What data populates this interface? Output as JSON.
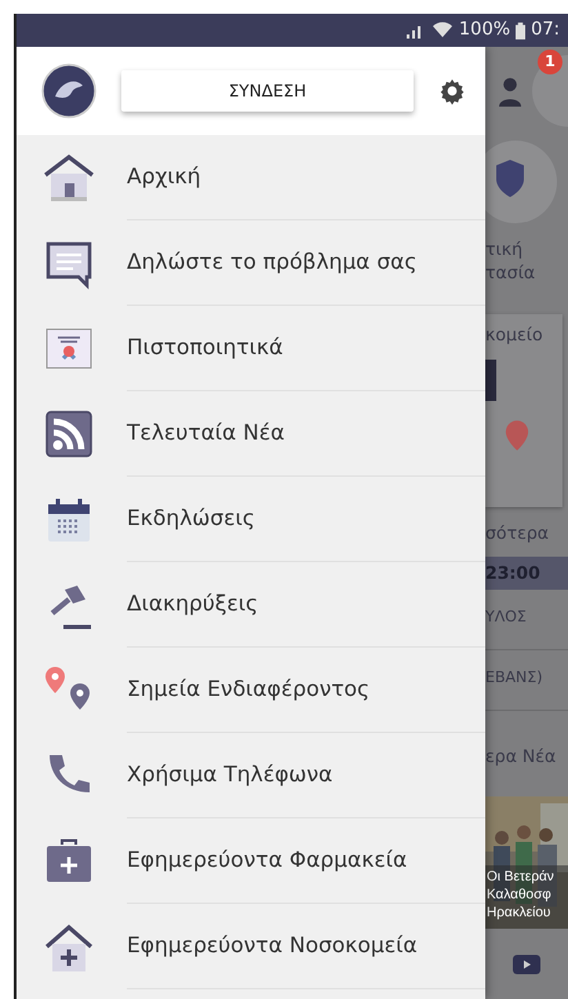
{
  "status_bar": {
    "battery": "100%",
    "time": "07:"
  },
  "drawer": {
    "login_button": "ΣΥΝΔΕΣΗ",
    "items": [
      {
        "kind": "home",
        "label": "Αρχική"
      },
      {
        "kind": "chat",
        "label": "Δηλώστε το πρόβλημα σας"
      },
      {
        "kind": "certificate",
        "label": "Πιστοποιητικά"
      },
      {
        "kind": "rss",
        "label": "Τελευταία Νέα"
      },
      {
        "kind": "calendar",
        "label": "Εκδηλώσεις"
      },
      {
        "kind": "gavel",
        "label": "Διακηρύξεις"
      },
      {
        "kind": "pins",
        "label": "Σημεία Ενδιαφέροντος"
      },
      {
        "kind": "phone",
        "label": "Χρήσιμα Τηλέφωνα"
      },
      {
        "kind": "pharmacy",
        "label": "Εφημερεύοντα Φαρμακεία"
      },
      {
        "kind": "hospital",
        "label": "Εφημερεύοντα Νοσοκομεία"
      }
    ]
  },
  "background": {
    "notification_count": "1",
    "service_label": [
      "τική",
      "τασία"
    ],
    "card_title": "κομείο",
    "more_link": "σότερα",
    "event_time": "23:00",
    "event_rows": [
      "ΥΛΟΣ",
      "ΕΒΑΝΣ)"
    ],
    "news_link": "ερα Νέα",
    "news_caption": [
      "Οι Βετεράν",
      "Καλαθοσφ",
      "Ηρακλείου"
    ]
  }
}
